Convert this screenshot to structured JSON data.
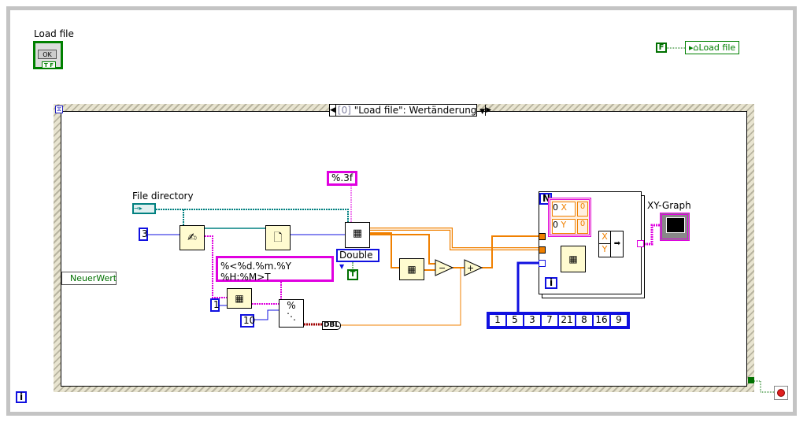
{
  "front_controls": {
    "load_file_label": "Load file",
    "ok_button": "OK",
    "tf_badge": "T F"
  },
  "local_variable": {
    "false_constant": "F",
    "label": "Load file"
  },
  "event_structure": {
    "case_index": "[0]",
    "case_label": "\"Load file\": Wertänderung",
    "event_data": "NeuerWert"
  },
  "diagram": {
    "file_directory_label": "File directory",
    "const_rows": "3",
    "format_precision": "%.3f",
    "type_enum": "Double",
    "transpose_constant": "T",
    "time_format": "%<%d.%m.%Y %H:%M>T",
    "index_constant": "1",
    "count_constant": "10",
    "dbl_conversion": "DBL",
    "loop_count": "N",
    "loop_iteration": "i",
    "cluster": {
      "x_label": "X",
      "y_label": "Y",
      "x_value": "0",
      "y_value": "0",
      "x_out": "0",
      "y_out": "0"
    },
    "bundle_labels": [
      "X",
      "Y"
    ],
    "array_constant": [
      "1",
      "5",
      "3",
      "7",
      "21",
      "8",
      "16",
      "9"
    ],
    "xy_graph_label": "XY-Graph",
    "iteration_terminal": "i"
  },
  "colors": {
    "numeric": "#1010e0",
    "string": "#e000e0",
    "boolean": "#007000",
    "double": "#f08000",
    "path": "#008080"
  }
}
